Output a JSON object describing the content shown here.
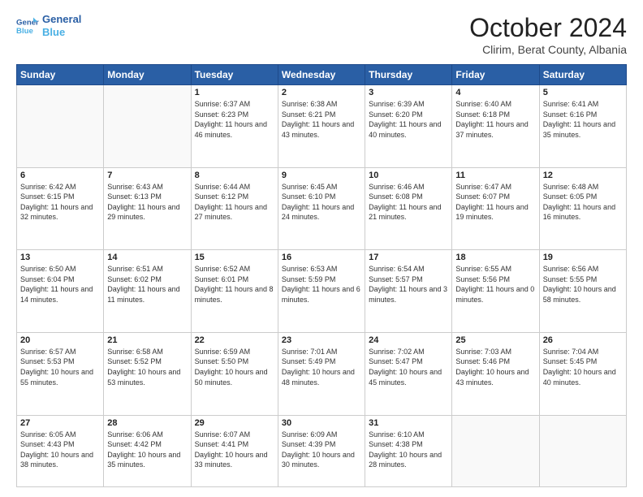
{
  "header": {
    "logo_line1": "General",
    "logo_line2": "Blue",
    "month_title": "October 2024",
    "location": "Clirim, Berat County, Albania"
  },
  "days_of_week": [
    "Sunday",
    "Monday",
    "Tuesday",
    "Wednesday",
    "Thursday",
    "Friday",
    "Saturday"
  ],
  "weeks": [
    [
      {
        "day": "",
        "info": ""
      },
      {
        "day": "",
        "info": ""
      },
      {
        "day": "1",
        "info": "Sunrise: 6:37 AM\nSunset: 6:23 PM\nDaylight: 11 hours and 46 minutes."
      },
      {
        "day": "2",
        "info": "Sunrise: 6:38 AM\nSunset: 6:21 PM\nDaylight: 11 hours and 43 minutes."
      },
      {
        "day": "3",
        "info": "Sunrise: 6:39 AM\nSunset: 6:20 PM\nDaylight: 11 hours and 40 minutes."
      },
      {
        "day": "4",
        "info": "Sunrise: 6:40 AM\nSunset: 6:18 PM\nDaylight: 11 hours and 37 minutes."
      },
      {
        "day": "5",
        "info": "Sunrise: 6:41 AM\nSunset: 6:16 PM\nDaylight: 11 hours and 35 minutes."
      }
    ],
    [
      {
        "day": "6",
        "info": "Sunrise: 6:42 AM\nSunset: 6:15 PM\nDaylight: 11 hours and 32 minutes."
      },
      {
        "day": "7",
        "info": "Sunrise: 6:43 AM\nSunset: 6:13 PM\nDaylight: 11 hours and 29 minutes."
      },
      {
        "day": "8",
        "info": "Sunrise: 6:44 AM\nSunset: 6:12 PM\nDaylight: 11 hours and 27 minutes."
      },
      {
        "day": "9",
        "info": "Sunrise: 6:45 AM\nSunset: 6:10 PM\nDaylight: 11 hours and 24 minutes."
      },
      {
        "day": "10",
        "info": "Sunrise: 6:46 AM\nSunset: 6:08 PM\nDaylight: 11 hours and 21 minutes."
      },
      {
        "day": "11",
        "info": "Sunrise: 6:47 AM\nSunset: 6:07 PM\nDaylight: 11 hours and 19 minutes."
      },
      {
        "day": "12",
        "info": "Sunrise: 6:48 AM\nSunset: 6:05 PM\nDaylight: 11 hours and 16 minutes."
      }
    ],
    [
      {
        "day": "13",
        "info": "Sunrise: 6:50 AM\nSunset: 6:04 PM\nDaylight: 11 hours and 14 minutes."
      },
      {
        "day": "14",
        "info": "Sunrise: 6:51 AM\nSunset: 6:02 PM\nDaylight: 11 hours and 11 minutes."
      },
      {
        "day": "15",
        "info": "Sunrise: 6:52 AM\nSunset: 6:01 PM\nDaylight: 11 hours and 8 minutes."
      },
      {
        "day": "16",
        "info": "Sunrise: 6:53 AM\nSunset: 5:59 PM\nDaylight: 11 hours and 6 minutes."
      },
      {
        "day": "17",
        "info": "Sunrise: 6:54 AM\nSunset: 5:57 PM\nDaylight: 11 hours and 3 minutes."
      },
      {
        "day": "18",
        "info": "Sunrise: 6:55 AM\nSunset: 5:56 PM\nDaylight: 11 hours and 0 minutes."
      },
      {
        "day": "19",
        "info": "Sunrise: 6:56 AM\nSunset: 5:55 PM\nDaylight: 10 hours and 58 minutes."
      }
    ],
    [
      {
        "day": "20",
        "info": "Sunrise: 6:57 AM\nSunset: 5:53 PM\nDaylight: 10 hours and 55 minutes."
      },
      {
        "day": "21",
        "info": "Sunrise: 6:58 AM\nSunset: 5:52 PM\nDaylight: 10 hours and 53 minutes."
      },
      {
        "day": "22",
        "info": "Sunrise: 6:59 AM\nSunset: 5:50 PM\nDaylight: 10 hours and 50 minutes."
      },
      {
        "day": "23",
        "info": "Sunrise: 7:01 AM\nSunset: 5:49 PM\nDaylight: 10 hours and 48 minutes."
      },
      {
        "day": "24",
        "info": "Sunrise: 7:02 AM\nSunset: 5:47 PM\nDaylight: 10 hours and 45 minutes."
      },
      {
        "day": "25",
        "info": "Sunrise: 7:03 AM\nSunset: 5:46 PM\nDaylight: 10 hours and 43 minutes."
      },
      {
        "day": "26",
        "info": "Sunrise: 7:04 AM\nSunset: 5:45 PM\nDaylight: 10 hours and 40 minutes."
      }
    ],
    [
      {
        "day": "27",
        "info": "Sunrise: 6:05 AM\nSunset: 4:43 PM\nDaylight: 10 hours and 38 minutes."
      },
      {
        "day": "28",
        "info": "Sunrise: 6:06 AM\nSunset: 4:42 PM\nDaylight: 10 hours and 35 minutes."
      },
      {
        "day": "29",
        "info": "Sunrise: 6:07 AM\nSunset: 4:41 PM\nDaylight: 10 hours and 33 minutes."
      },
      {
        "day": "30",
        "info": "Sunrise: 6:09 AM\nSunset: 4:39 PM\nDaylight: 10 hours and 30 minutes."
      },
      {
        "day": "31",
        "info": "Sunrise: 6:10 AM\nSunset: 4:38 PM\nDaylight: 10 hours and 28 minutes."
      },
      {
        "day": "",
        "info": ""
      },
      {
        "day": "",
        "info": ""
      }
    ]
  ]
}
